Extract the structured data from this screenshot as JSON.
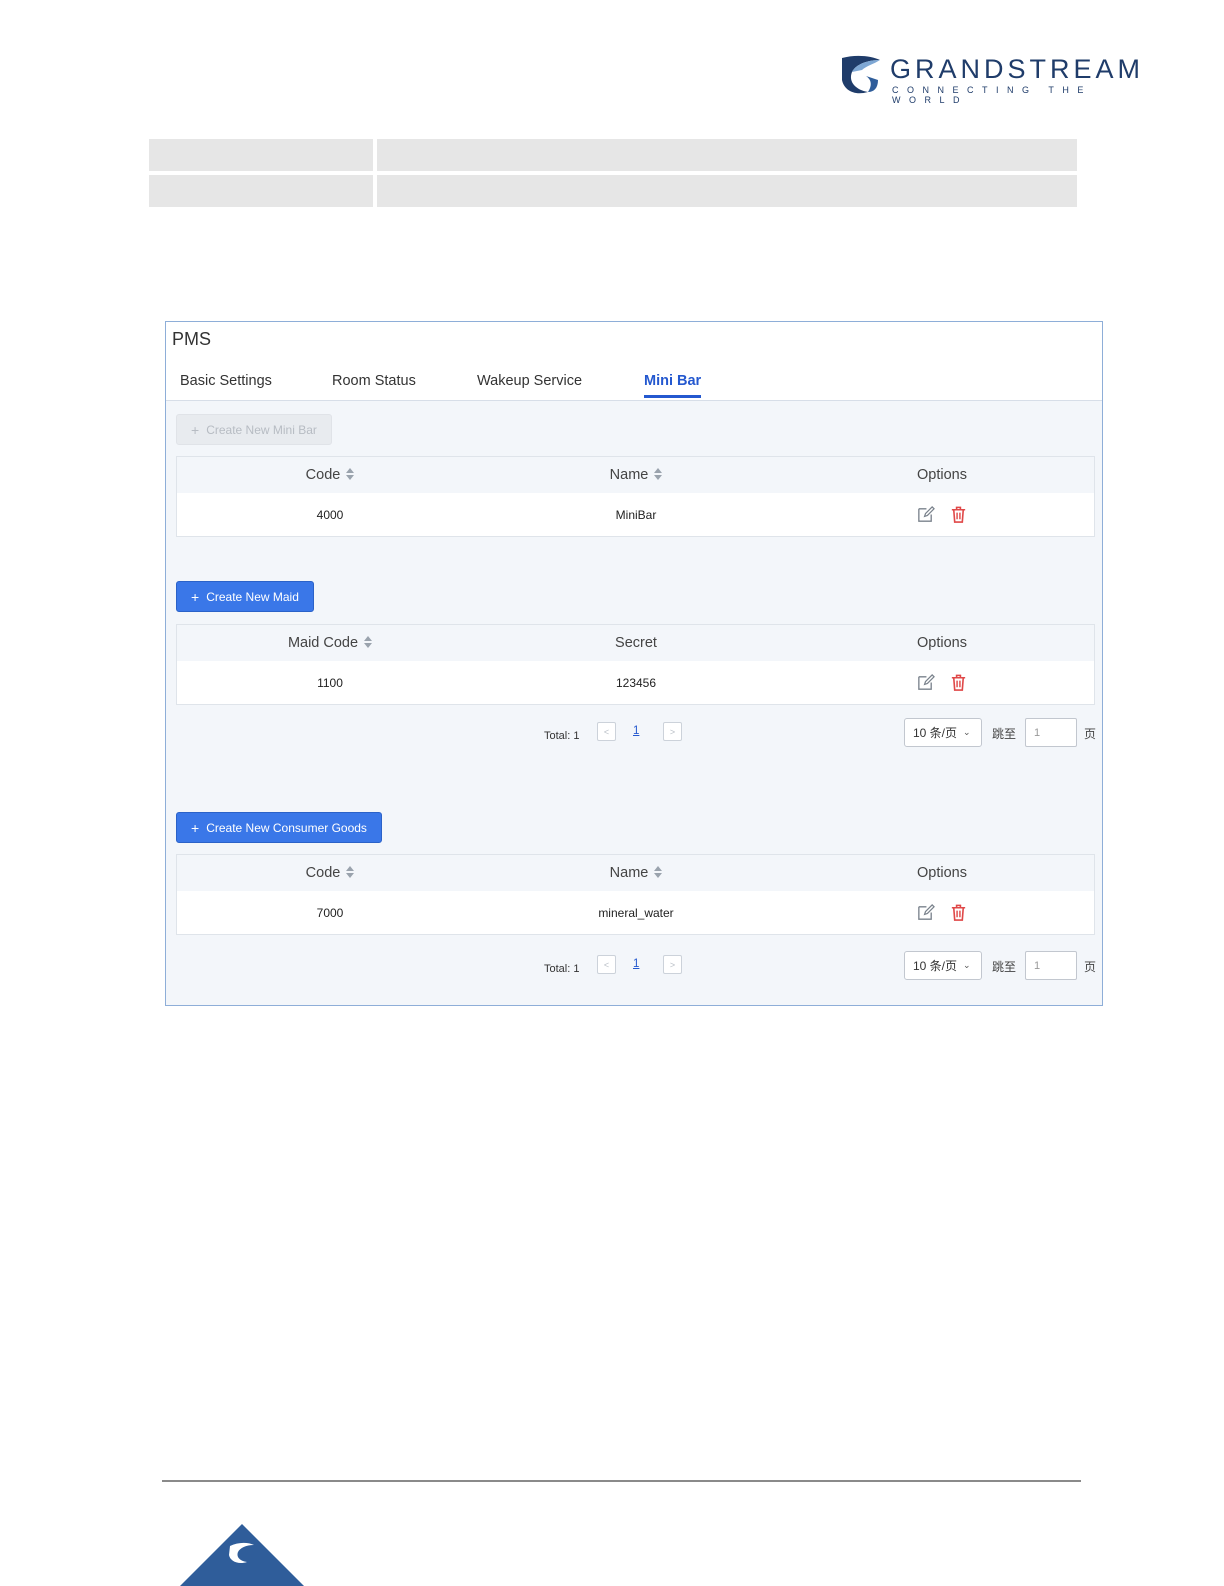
{
  "brand": {
    "name": "GRANDSTREAM",
    "tagline": "CONNECTING THE WORLD"
  },
  "pms": {
    "title": "PMS",
    "tabs": [
      {
        "label": "Basic Settings",
        "active": false
      },
      {
        "label": "Room Status",
        "active": false
      },
      {
        "label": "Wakeup Service",
        "active": false
      },
      {
        "label": "Mini Bar",
        "active": true
      }
    ],
    "minibar": {
      "create_label": "Create New Mini Bar",
      "create_disabled": true,
      "headers": [
        "Code",
        "Name",
        "Options"
      ],
      "rows": [
        {
          "code": "4000",
          "name": "MiniBar"
        }
      ]
    },
    "maid": {
      "create_label": "Create New Maid",
      "headers": [
        "Maid Code",
        "Secret",
        "Options"
      ],
      "rows": [
        {
          "code": "1100",
          "secret": "123456"
        }
      ],
      "pager": {
        "total": "Total: 1",
        "page": "1",
        "page_size": "10 条/页",
        "jump_label": "跳至",
        "jump_value": "1",
        "page_suffix": "页"
      }
    },
    "goods": {
      "create_label": "Create New Consumer Goods",
      "headers": [
        "Code",
        "Name",
        "Options"
      ],
      "rows": [
        {
          "code": "7000",
          "name": "mineral_water"
        }
      ],
      "pager": {
        "total": "Total: 1",
        "page": "1",
        "page_size": "10 条/页",
        "jump_label": "跳至",
        "jump_value": "1",
        "page_suffix": "页"
      }
    }
  },
  "colors": {
    "accent": "#2458cf",
    "button": "#3a77e8",
    "delete": "#e04848",
    "brand": "#1f3c6a"
  },
  "icons": {
    "edit": "edit-icon",
    "delete": "trash-icon",
    "sort": "sort-icon",
    "plus": "plus-icon"
  }
}
